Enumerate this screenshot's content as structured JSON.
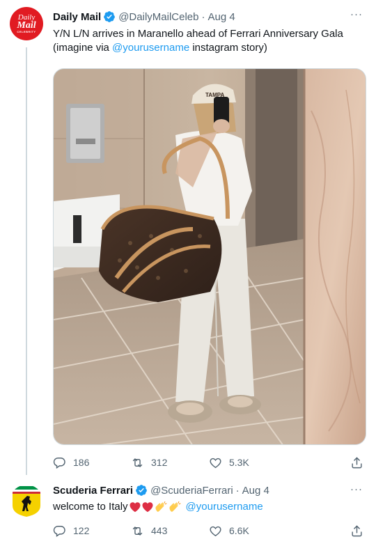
{
  "tweets": [
    {
      "author_name": "Daily Mail",
      "handle": "@DailyMailCeleb",
      "date": "Aug 4",
      "avatar_lines": [
        "Daily",
        "Mail",
        "CELEBRITY"
      ],
      "text_line1": "Y/N L/N arrives in Maranello ahead of Ferrari Anniversary Gala",
      "text_line2_prefix": "(imagine via ",
      "text_mention": "@yourusername",
      "text_line2_suffix": " instagram story)",
      "cap_text": "TAMPA",
      "replies": "186",
      "retweets": "312",
      "likes": "5.3K"
    },
    {
      "author_name": "Scuderia Ferrari",
      "handle": "@ScuderiaFerrari",
      "date": "Aug 4",
      "text_prefix": "welcome to Italy",
      "text_mention": "@yourusername",
      "replies": "122",
      "retweets": "443",
      "likes": "6.6K"
    }
  ],
  "ui": {
    "dot": "·",
    "more": "···"
  },
  "colors": {
    "accent": "#1d9bf0",
    "muted": "#536471",
    "daily_mail_red": "#e11b22",
    "ferrari_yellow": "#f5d100",
    "heart_red": "#dd2e44"
  },
  "icons": [
    "verified-badge-icon",
    "more-icon",
    "reply-icon",
    "retweet-icon",
    "like-icon",
    "share-icon",
    "red-heart-emoji",
    "clapping-hands-emoji",
    "prancing-horse-logo"
  ]
}
